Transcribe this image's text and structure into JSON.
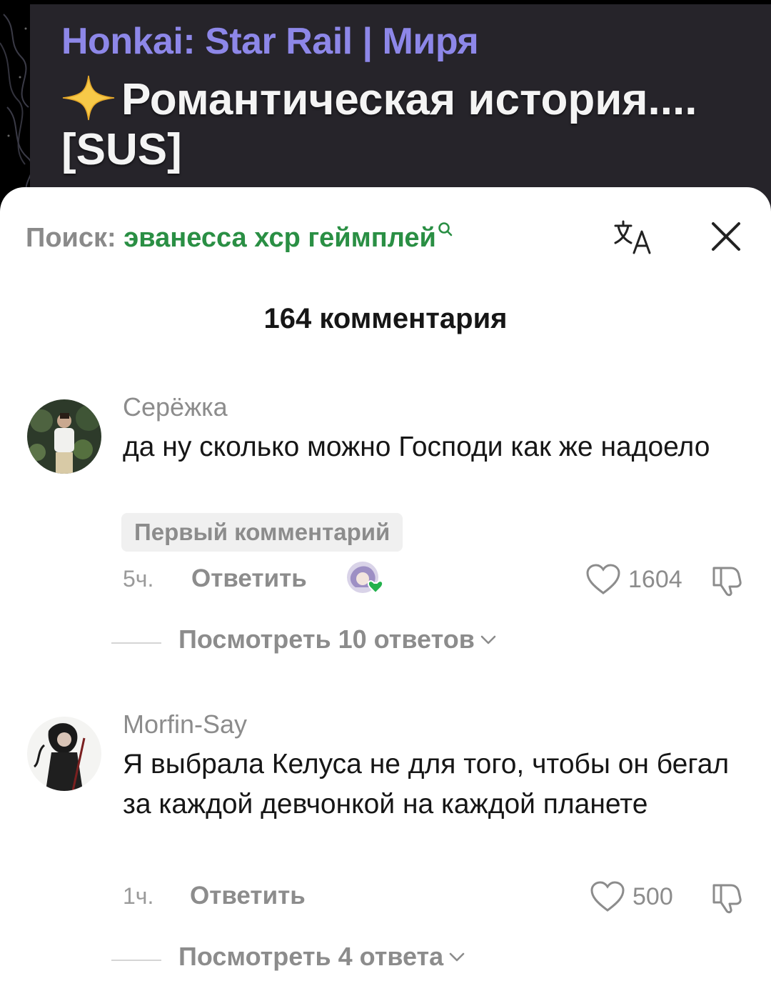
{
  "video": {
    "channel": "Honkai: Star Rail | Миря",
    "title": "Романтическая история.... [SUS]"
  },
  "sheet": {
    "search_label": "Поиск:",
    "search_query": "эванесса хср геймплей",
    "comments_count": "164 комментария"
  },
  "comments": [
    {
      "username": "Серёжка",
      "text": "да ну сколько можно Господи как же надоело",
      "badge": "Первый комментарий",
      "time": "5ч.",
      "reply_label": "Ответить",
      "likes": "1604",
      "view_replies": "Посмотреть 10 ответов"
    },
    {
      "username": "Morfin-Say",
      "text": "Я выбрала Келуса не для того, чтобы он бегал за каждой девчонкой на каждой планете",
      "time": "1ч.",
      "reply_label": "Ответить",
      "likes": "500",
      "view_replies": "Посмотреть 4 ответа"
    }
  ],
  "colors": {
    "channel": "#8d87e8",
    "search_query": "#2a8f44",
    "creator_liked_heart": "#22b14c"
  },
  "icons": [
    "sparkle-icon",
    "search-icon",
    "translate-icon",
    "close-icon",
    "heart-icon",
    "dislike-icon",
    "chevron-down-icon"
  ]
}
